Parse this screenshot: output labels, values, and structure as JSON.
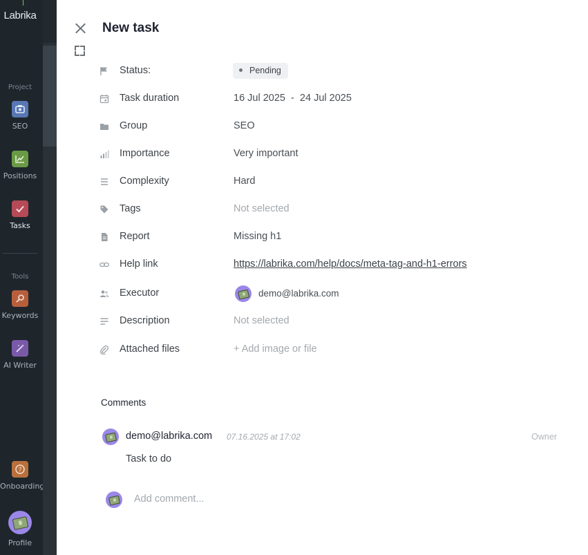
{
  "sidebar": {
    "logo": "Labrika",
    "section_project": "Project",
    "section_tools": "Tools",
    "items": [
      {
        "label": "SEO",
        "icon": "seo-icon",
        "color": "#5877b3"
      },
      {
        "label": "Positions",
        "icon": "chart-icon",
        "color": "#6b9a45"
      },
      {
        "label": "Tasks",
        "icon": "check-icon",
        "color": "#b64a57"
      },
      {
        "label": "Keywords",
        "icon": "key-search-icon",
        "color": "#b75f3d"
      },
      {
        "label": "AI Writer",
        "icon": "magic-wand-icon",
        "color": "#7a5aa8"
      },
      {
        "label": "Onboarding",
        "icon": "question-icon",
        "color": "#b9703c"
      },
      {
        "label": "Profile",
        "icon": "avatar-icon",
        "color": "#9b87e8"
      }
    ]
  },
  "drawer": {
    "title": "New task",
    "fields": {
      "status": {
        "label": "Status:",
        "value": "Pending"
      },
      "duration": {
        "label": "Task duration",
        "value": "16 Jul 2025  -  24 Jul 2025"
      },
      "group": {
        "label": "Group",
        "value": "SEO"
      },
      "importance": {
        "label": "Importance",
        "value": "Very important"
      },
      "complexity": {
        "label": "Complexity",
        "value": "Hard"
      },
      "tags": {
        "label": "Tags",
        "value": "Not selected"
      },
      "report": {
        "label": "Report",
        "value": "Missing h1"
      },
      "help_link": {
        "label": "Help link",
        "value": "https://labrika.com/help/docs/meta-tag-and-h1-errors"
      },
      "executor": {
        "label": "Executor",
        "value": "demo@labrika.com"
      },
      "description": {
        "label": "Description",
        "value": "Not selected"
      },
      "attached": {
        "label": "Attached files",
        "value": "+ Add image or file"
      }
    },
    "comments": {
      "heading": "Comments",
      "items": [
        {
          "author": "demo@labrika.com",
          "date": "07.16.2025 at 17:02",
          "role": "Owner",
          "text": "Task to do"
        }
      ],
      "add_placeholder": "Add comment..."
    }
  },
  "colors": {
    "accent_green": "#7cc24b",
    "pill_bg": "#eef0f3",
    "avatar": "#9b87e8"
  }
}
